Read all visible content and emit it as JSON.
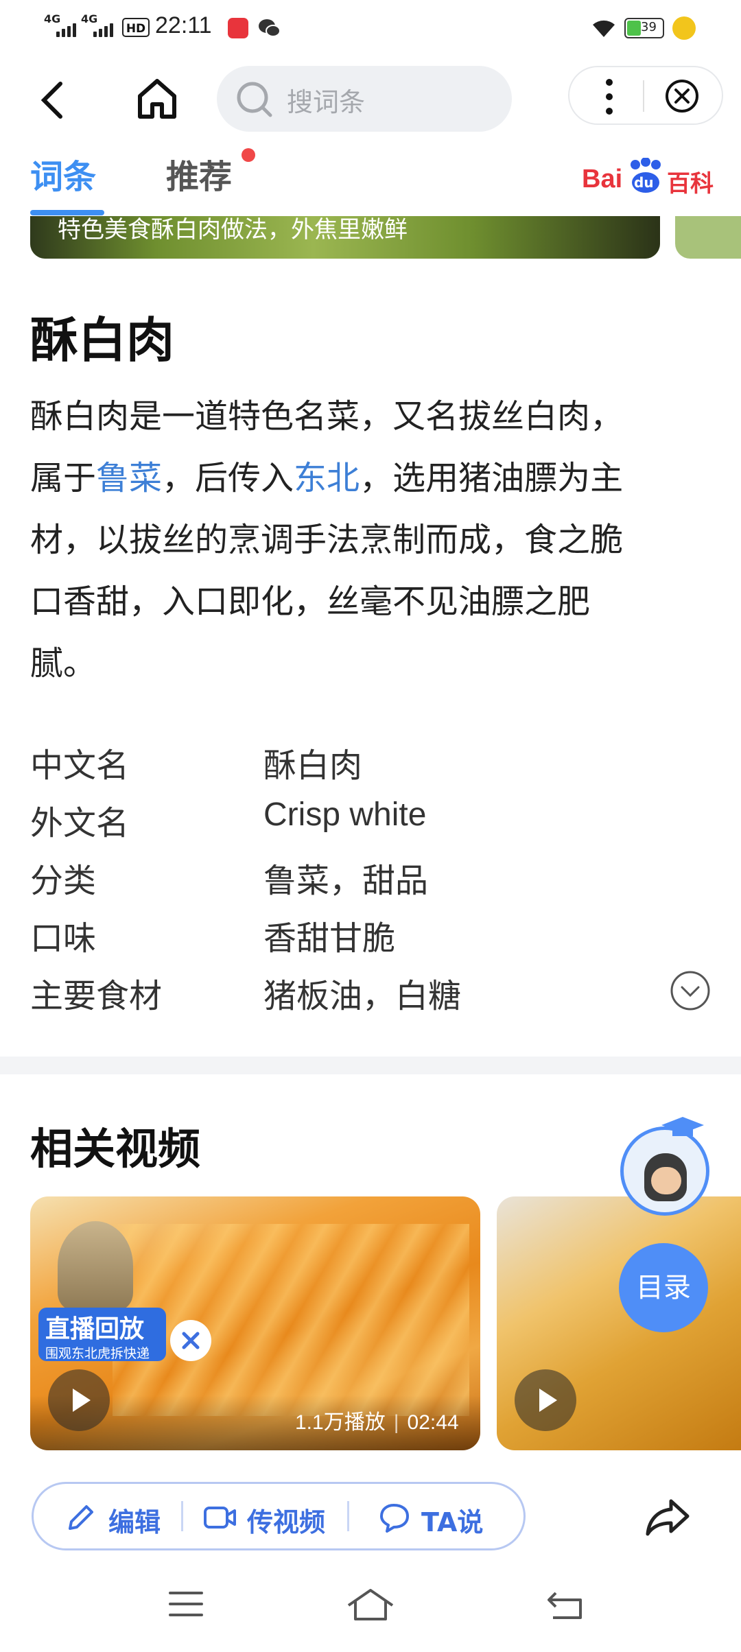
{
  "status_bar": {
    "time": "22:11",
    "signal_1": "4G",
    "signal_2": "4G",
    "hd": "HD",
    "battery": "39"
  },
  "nav": {
    "search_placeholder": "搜词条"
  },
  "tabs": [
    {
      "label": "词条",
      "active": true
    },
    {
      "label": "推荐",
      "active": false
    }
  ],
  "brand": {
    "logo_text_1": "Bai",
    "logo_text_2": "du",
    "logo_text_3": "百科",
    "colors": {
      "red": "#e8343c",
      "blue": "#2d5ee8"
    }
  },
  "video_strip": {
    "caption": "特色美食酥白肉做法，外焦里嫩鲜"
  },
  "article": {
    "title": "酥白肉",
    "summary_pre": "酥白肉是一道特色名菜，又名拔丝白肉，",
    "summary_p2": "属于",
    "link_1": "鲁菜",
    "summary_p3": "，后传入",
    "link_2": "东北",
    "summary_p4": "，选用猪油膘为主",
    "summary_line3": "材，以拔丝的烹调手法烹制而成，食之脆",
    "summary_line4": "口香甜，入口即化，丝毫不见油膘之肥",
    "summary_line5": "腻。"
  },
  "infobox": [
    {
      "key": "中文名",
      "value": "酥白肉"
    },
    {
      "key": "外文名",
      "value": "Crisp white"
    },
    {
      "key": "分类",
      "value": "鲁菜，甜品"
    },
    {
      "key": "口味",
      "value": "香甜甘脆"
    },
    {
      "key": "主要食材",
      "value": "猪板油，白糖"
    }
  ],
  "related_videos": {
    "title": "相关视频",
    "items": [
      {
        "badge_title": "直播回放",
        "badge_sub": "围观东北虎拆快递",
        "plays": "1.1万播放",
        "duration": "02:44"
      },
      {}
    ]
  },
  "float": {
    "toc_label": "目录"
  },
  "bottom_bar": {
    "edit": "编辑",
    "upload_video": "传视频",
    "ta_say": "TA说"
  },
  "accent": "#3d8ff2"
}
